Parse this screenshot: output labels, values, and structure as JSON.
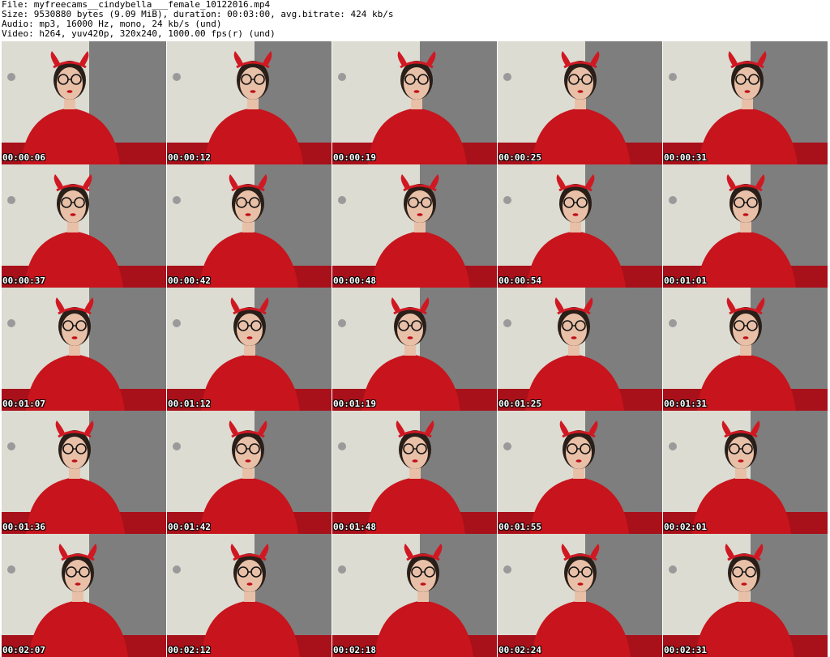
{
  "header": {
    "file_line": "File: myfreecams__cindybella___female_10122016.mp4",
    "size_line": "Size: 9530880 bytes (9.09 MiB), duration: 00:03:00, avg.bitrate: 424 kb/s",
    "audio_line": "Audio: mp3, 16000 Hz, mono, 24 kb/s (und)",
    "video_line": "Video: h264, yuv420p, 320x240, 1000.00 fps(r) (und)"
  },
  "colors": {
    "shirt": "#c8141c",
    "wall_light": "#dcdcd2",
    "wall_dark": "#7e7e7e",
    "skin": "#e8c0a8",
    "hair": "#2a1e18"
  },
  "thumbnails": [
    {
      "timestamp": "00:00:06"
    },
    {
      "timestamp": "00:00:12"
    },
    {
      "timestamp": "00:00:19"
    },
    {
      "timestamp": "00:00:25"
    },
    {
      "timestamp": "00:00:31"
    },
    {
      "timestamp": "00:00:37"
    },
    {
      "timestamp": "00:00:42"
    },
    {
      "timestamp": "00:00:48"
    },
    {
      "timestamp": "00:00:54"
    },
    {
      "timestamp": "00:01:01"
    },
    {
      "timestamp": "00:01:07"
    },
    {
      "timestamp": "00:01:12"
    },
    {
      "timestamp": "00:01:19"
    },
    {
      "timestamp": "00:01:25"
    },
    {
      "timestamp": "00:01:31"
    },
    {
      "timestamp": "00:01:36"
    },
    {
      "timestamp": "00:01:42"
    },
    {
      "timestamp": "00:01:48"
    },
    {
      "timestamp": "00:01:55"
    },
    {
      "timestamp": "00:02:01"
    },
    {
      "timestamp": "00:02:07"
    },
    {
      "timestamp": "00:02:12"
    },
    {
      "timestamp": "00:02:18"
    },
    {
      "timestamp": "00:02:24"
    },
    {
      "timestamp": "00:02:31"
    }
  ]
}
